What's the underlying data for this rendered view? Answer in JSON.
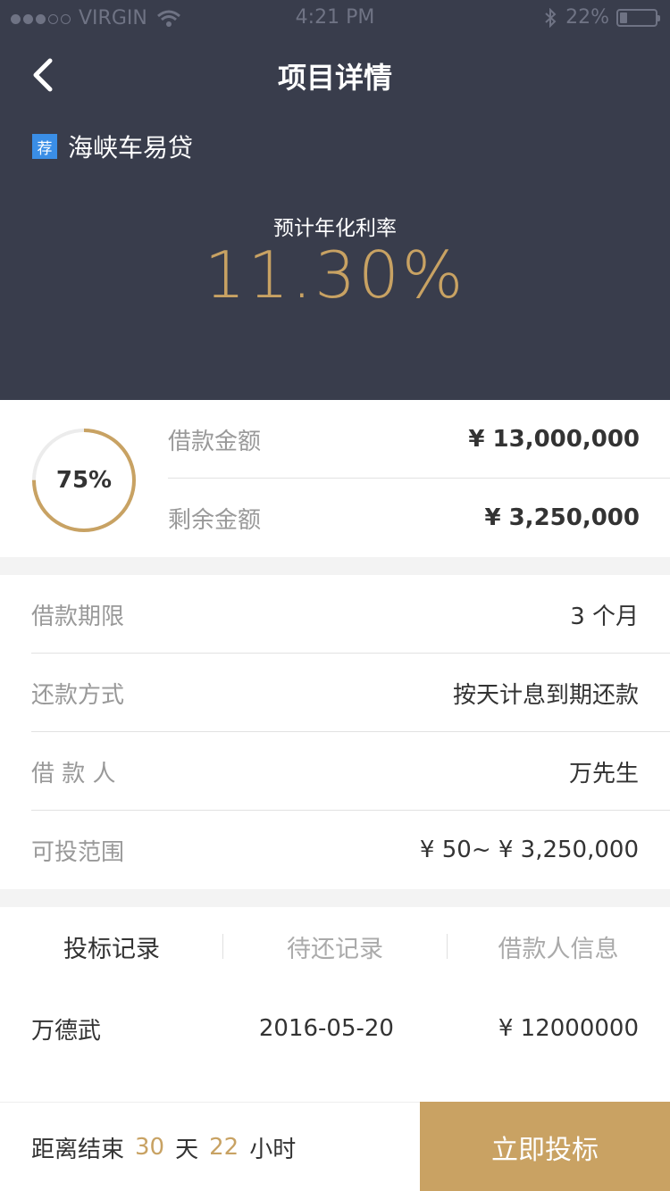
{
  "status_bar": {
    "carrier": "VIRGIN",
    "time": "4:21 PM",
    "battery": "22%",
    "battery_level": 0.22
  },
  "nav": {
    "title": "项目详情"
  },
  "product": {
    "tag": "荐",
    "name": "海峡车易贷"
  },
  "rate": {
    "label": "预计年化利率",
    "value": "11.30%"
  },
  "progress": {
    "percent_text": "75%",
    "fraction": 0.75
  },
  "amounts": {
    "loan_label": "借款金额",
    "loan_value": "¥ 13,000,000",
    "remain_label": "剩余金额",
    "remain_value": "¥ 3,250,000"
  },
  "info": [
    {
      "label": "借款期限",
      "value": "3 个月"
    },
    {
      "label": "还款方式",
      "value": "按天计息到期还款"
    },
    {
      "label": "借 款 人",
      "value": "万先生"
    },
    {
      "label": "可投范围",
      "value": "¥ 50~ ¥ 3,250,000"
    }
  ],
  "tabs": [
    "投标记录",
    "待还记录",
    "借款人信息"
  ],
  "records": [
    {
      "name": "万德武",
      "date": "2016-05-20",
      "amount": "¥ 12000000"
    }
  ],
  "footer": {
    "prefix": "距离结束",
    "days": "30",
    "days_unit": "天",
    "hours": "22",
    "hours_unit": "小时",
    "button": "立即投标"
  },
  "colors": {
    "header_bg": "#393d4c",
    "accent": "#c8a263",
    "tag_blue": "#3a8ee6"
  }
}
